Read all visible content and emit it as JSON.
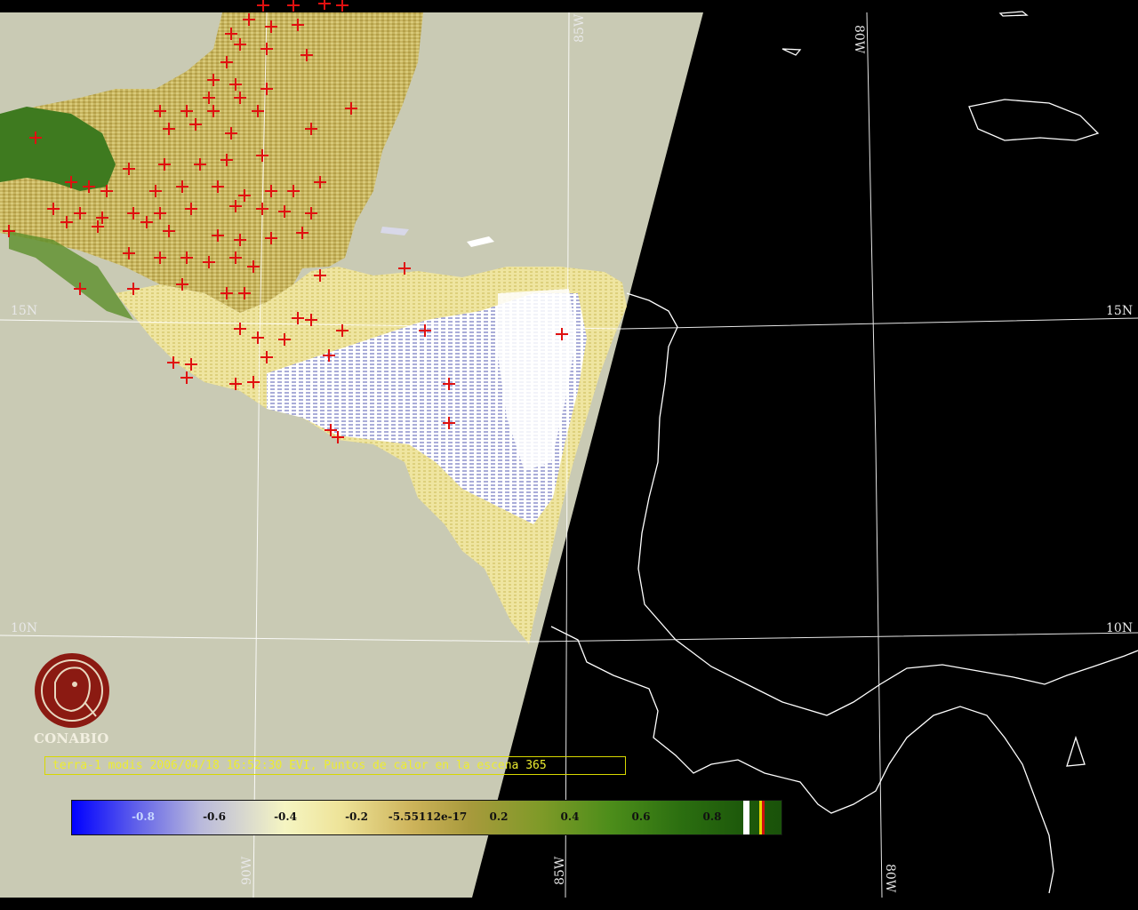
{
  "map": {
    "grid_labels": {
      "lat_15_left": "15N",
      "lat_15_right": "15N",
      "lat_10_left": "10N",
      "lat_10_right": "10N",
      "lon_85_top": "85W",
      "lon_80_top": "80W",
      "lon_90_bottom": "90W",
      "lon_85_bottom": "85W",
      "lon_80_bottom": "80W"
    },
    "colors": {
      "background_no_data": "#c9cab4",
      "night_side": "#000000",
      "coastline": "#ffffff",
      "graticule": "#ffffff",
      "hotspot_marker": "#e01010"
    },
    "hotspot_marker_icon": "cross-icon"
  },
  "branding": {
    "logo_icon": "conabio-seal-icon",
    "logo_text": "CONABIO"
  },
  "caption": {
    "text": "terra-1 modis 2006/04/18 16:52:30 EVI, Puntos de calor en la escena 365"
  },
  "colorbar": {
    "ticks": [
      "-0.8",
      "-0.6",
      "-0.4",
      "-0.2",
      "-5.55112e-17",
      "0.2",
      "0.4",
      "0.6",
      "0.8"
    ],
    "range": [
      -1.0,
      1.0
    ]
  }
}
